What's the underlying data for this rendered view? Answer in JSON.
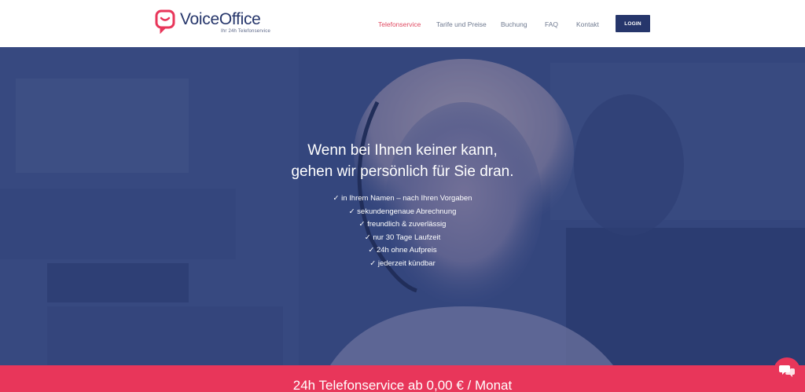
{
  "brand": {
    "name": "VoiceOffice",
    "tagline": "Ihr 24h Telefonservice",
    "logo_icon": "speech-bubble-icon",
    "brand_color": "#e8365a",
    "navy_color": "#26366b"
  },
  "nav": {
    "items": [
      {
        "label": "Telefonservice",
        "active": true
      },
      {
        "label": "Tarife und Preise",
        "active": false
      },
      {
        "label": "Buchung",
        "active": false
      },
      {
        "label": "FAQ",
        "active": false
      },
      {
        "label": "Kontakt",
        "active": false
      }
    ],
    "login_label": "LOGIN"
  },
  "hero": {
    "headline_1": "Wenn bei Ihnen keiner kann,",
    "headline_2": "gehen wir persönlich für Sie dran.",
    "checklist": [
      "✓ in Ihrem Namen – nach Ihren Vorgaben",
      "✓ sekundengenaue Abrechnung",
      "✓ freundlich & zuverlässig",
      "✓ nur 30 Tage Laufzeit",
      "✓ 24h ohne Aufpreis",
      "✓ jederzeit kündbar"
    ]
  },
  "band": {
    "text": "24h Telefonservice ab 0,00 € / Monat"
  },
  "chat": {
    "icon": "chat-bubbles-icon"
  }
}
